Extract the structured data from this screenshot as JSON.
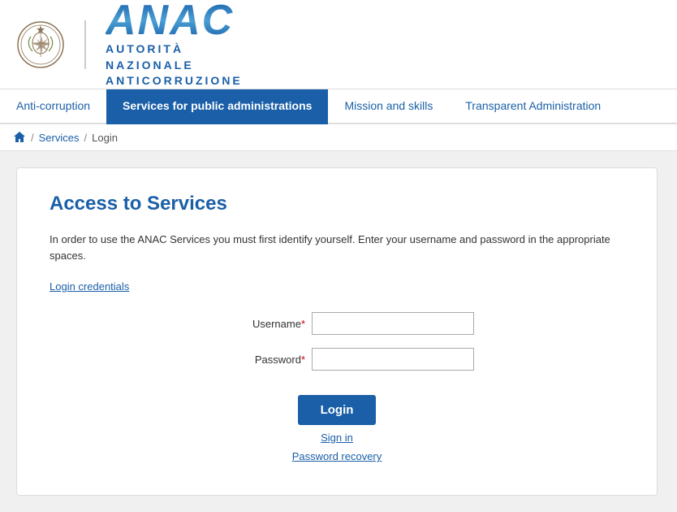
{
  "header": {
    "anac_big": "ANAC",
    "subtitle_line1": "AUTORITÀ",
    "subtitle_line2": "NAZIONALE",
    "subtitle_line3": "ANTICORRUZIONE"
  },
  "nav": {
    "items": [
      {
        "label": "Anti-corruption",
        "active": false
      },
      {
        "label": "Services for public administrations",
        "active": true
      },
      {
        "label": "Mission and skills",
        "active": false
      },
      {
        "label": "Transparent Administration",
        "active": false
      }
    ]
  },
  "breadcrumb": {
    "services": "Services",
    "login": "Login"
  },
  "card": {
    "title": "Access to Services",
    "description": "In order to use the ANAC Services you must first identify yourself. Enter your username and password in the appropriate spaces.",
    "credentials_link": "Login credentials",
    "username_label": "Username",
    "password_label": "Password",
    "required_marker": "*",
    "login_button": "Login",
    "sign_in_link": "Sign in",
    "password_recovery_link": "Password recovery"
  }
}
